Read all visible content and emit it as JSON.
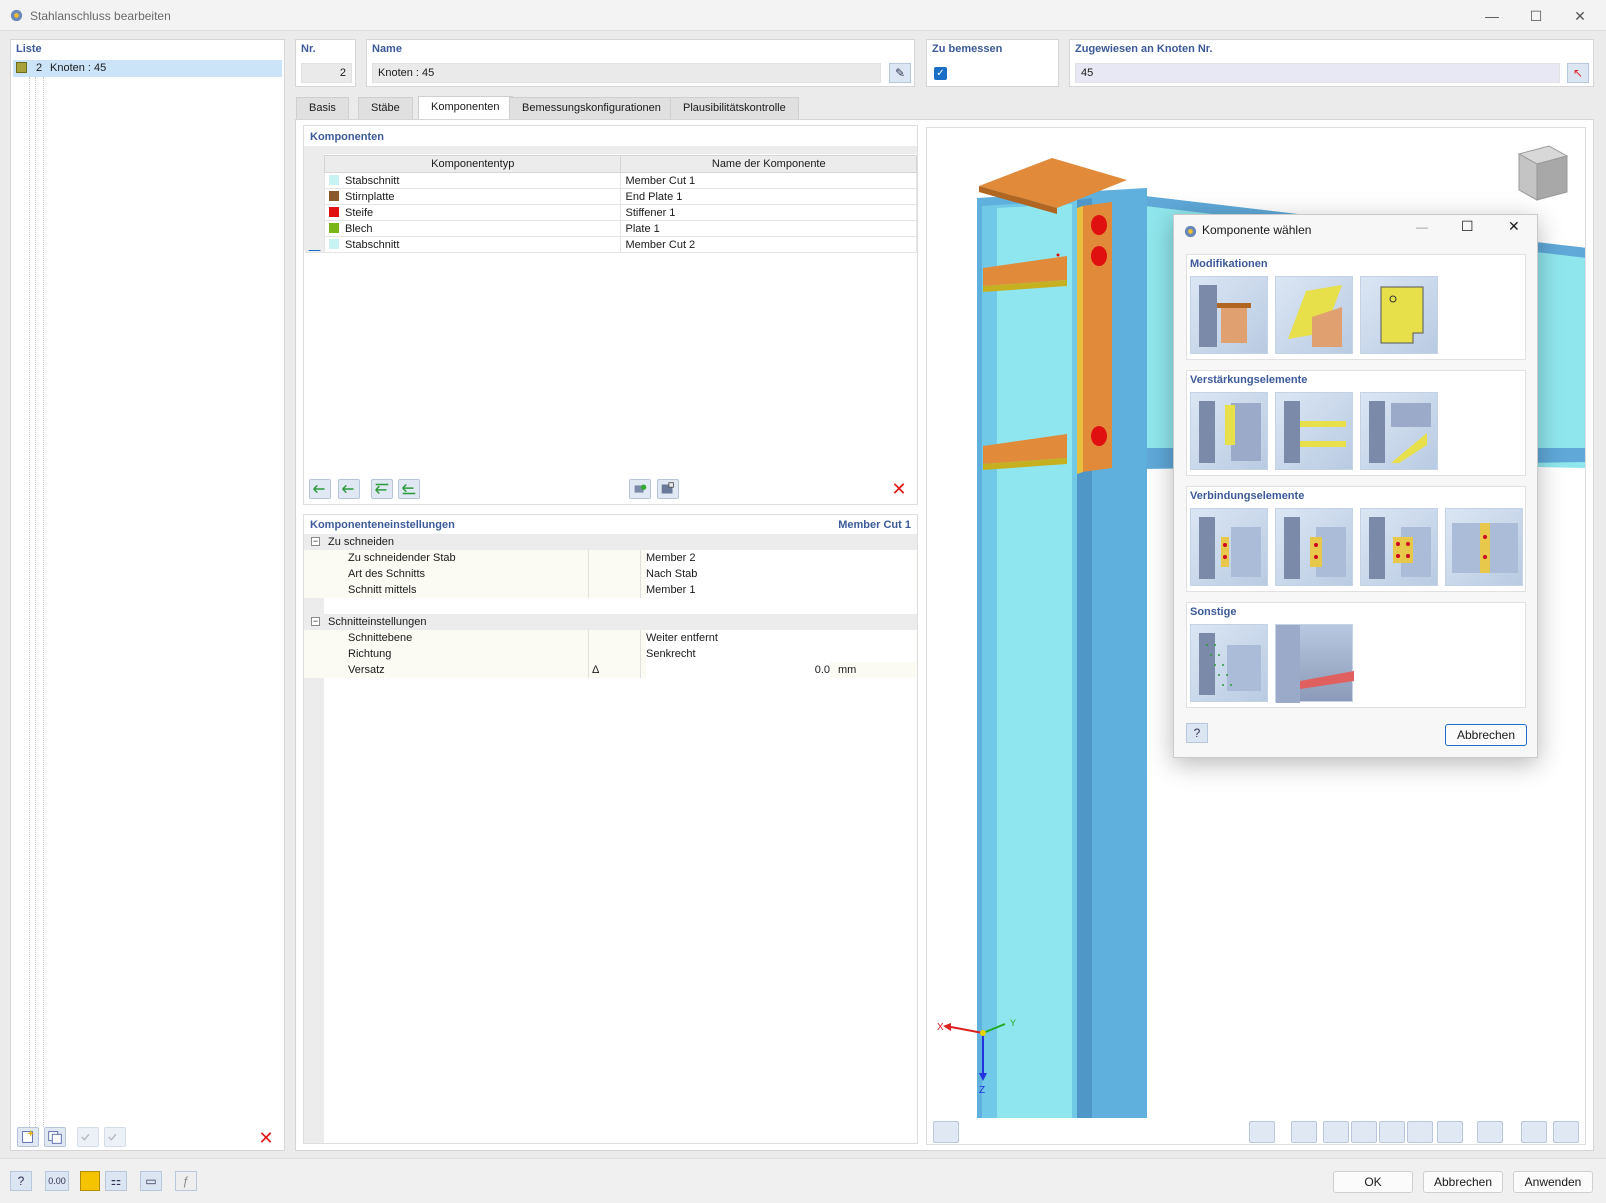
{
  "window": {
    "title": "Stahlanschluss bearbeiten",
    "minimize": "—",
    "maximize": "☐",
    "close": "✕"
  },
  "list": {
    "title": "Liste",
    "items": [
      {
        "number": "2",
        "label": "Knoten : 45",
        "color": "#a7a23a"
      }
    ]
  },
  "header": {
    "nr_label": "Nr.",
    "nr_value": "2",
    "name_label": "Name",
    "name_value": "Knoten : 45",
    "design_label": "Zu bemessen",
    "assigned_label": "Zugewiesen an Knoten Nr.",
    "assigned_value": "45"
  },
  "tabs": [
    "Basis",
    "Stäbe",
    "Komponenten",
    "Bemessungskonfigurationen",
    "Plausibilitätskontrolle"
  ],
  "components": {
    "title": "Komponenten",
    "col_type": "Komponententyp",
    "col_name": "Name der Komponente",
    "rows": [
      {
        "checked": false,
        "type": "Stabschnitt",
        "name": "Member Cut 1",
        "color": "#c8f3f3"
      },
      {
        "checked": true,
        "type": "Stirnplatte",
        "name": "End Plate 1",
        "color": "#8a5a2b"
      },
      {
        "checked": true,
        "type": "Steife",
        "name": "Stiffener 1",
        "color": "#e01010"
      },
      {
        "checked": true,
        "type": "Blech",
        "name": "Plate 1",
        "color": "#7ab51a"
      },
      {
        "checked": true,
        "type": "Stabschnitt",
        "name": "Member Cut 2",
        "color": "#c8f3f3"
      }
    ]
  },
  "settings": {
    "title": "Komponenteneinstellungen",
    "current": "Member Cut 1",
    "group1": "Zu schneiden",
    "g1_rows": [
      {
        "label": "Zu schneidender Stab",
        "value": "Member 2"
      },
      {
        "label": "Art des Schnitts",
        "value": "Nach Stab"
      },
      {
        "label": "Schnitt mittels",
        "value": "Member 1"
      }
    ],
    "group2": "Schnitteinstellungen",
    "g2_rows": [
      {
        "label": "Schnittebene",
        "value": "Weiter entfernt"
      },
      {
        "label": "Richtung",
        "value": "Senkrecht"
      }
    ],
    "offset_label": "Versatz",
    "offset_symbol": "Δ",
    "offset_value": "0.0",
    "offset_unit": "mm"
  },
  "dialog": {
    "title": "Komponente wählen",
    "sections": [
      "Modifikationen",
      "Verstärkungselemente",
      "Verbindungselemente",
      "Sonstige"
    ],
    "cancel": "Abbrechen"
  },
  "axes": {
    "x": "X",
    "y": "Y",
    "z": "Z"
  },
  "footer": {
    "ok": "OK",
    "cancel": "Abbrechen",
    "apply": "Anwenden",
    "numeric_icon": "0.00"
  }
}
